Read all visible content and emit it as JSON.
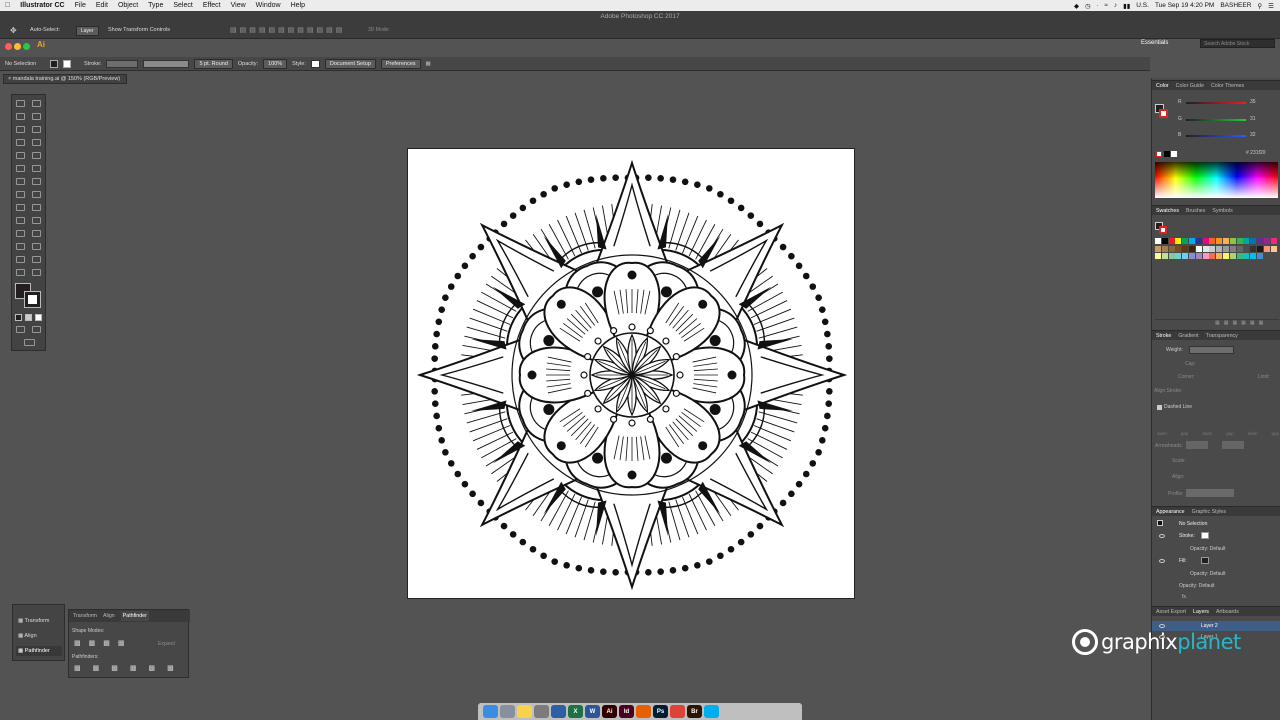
{
  "menubar": {
    "apple": "",
    "app_name": "Illustrator CC",
    "items": [
      "File",
      "Edit",
      "Object",
      "Type",
      "Select",
      "Effect",
      "View",
      "Window",
      "Help"
    ],
    "right": {
      "locale": "U.S.",
      "clock": "Tue Sep 19  4:20 PM",
      "user": "BASHEER"
    }
  },
  "window_title": "Adobe Photoshop CC 2017",
  "options": {
    "auto_select": "Auto-Select:",
    "auto_select_value": "Layer",
    "show_transform": "Show Transform Controls",
    "mode3d": "3D Mode:",
    "workspace": "Essentials",
    "search_placeholder": "Search Adobe Stock"
  },
  "control": {
    "selection": "No Selection",
    "stroke_label": "Stroke:",
    "brush": "5 pt. Round",
    "opacity_label": "Opacity:",
    "opacity_value": "100%",
    "style_label": "Style:",
    "document_setup": "Document Setup",
    "preferences": "Preferences"
  },
  "document_tab": "mandala training.ai @ 150% (RGB/Preview)",
  "color_panel": {
    "tabs": [
      "Color",
      "Color Guide",
      "Color Themes"
    ],
    "r_label": "R",
    "r_value": "35",
    "g_label": "G",
    "g_value": "31",
    "b_label": "B",
    "b_value": "32",
    "hex_value": "231f20"
  },
  "swatches_panel": {
    "tabs": [
      "Swatches",
      "Brushes",
      "Symbols"
    ],
    "colors": [
      "#ffffff",
      "#000000",
      "#ed1c24",
      "#fff200",
      "#00a651",
      "#00aeef",
      "#2e3192",
      "#ec008c",
      "#f26522",
      "#f7941d",
      "#fbaf5d",
      "#8dc63f",
      "#39b54a",
      "#00a99d",
      "#0072bc",
      "#662d91",
      "#92278f",
      "#ee2a7b",
      "#c69c6d",
      "#a67c52",
      "#8c6239",
      "#754c24",
      "#603913",
      "#3c2415",
      "#ffffff",
      "#e6e6e6",
      "#cccccc",
      "#b3b3b3",
      "#999999",
      "#808080",
      "#666666",
      "#4d4d4d",
      "#333333",
      "#1a1a1a",
      "#f7977a",
      "#fdc68a",
      "#fff79a",
      "#c4df9b",
      "#82ca9c",
      "#7accc8",
      "#6dcff6",
      "#8393ca",
      "#a187be",
      "#f49ac2",
      "#f26c4f",
      "#fbaf5d",
      "#fff467",
      "#acd373",
      "#3cb878",
      "#1cbbb4",
      "#00bff3",
      "#448ccb"
    ]
  },
  "stroke_panel": {
    "tabs": [
      "Stroke",
      "Gradient",
      "Transparency"
    ],
    "weight_label": "Weight:",
    "cap_label": "Cap:",
    "corner_label": "Corner:",
    "limit_label": "Limit:",
    "align_label": "Align Stroke:",
    "dashed_label": "Dashed Line",
    "dash_labels": [
      "dash",
      "gap",
      "dash",
      "gap",
      "dash",
      "gap"
    ],
    "arrowheads_label": "Arrowheads:",
    "scale_label": "Scale:",
    "align2_label": "Align:",
    "profile_label": "Profile:"
  },
  "appearance_panel": {
    "tabs": [
      "Appearance",
      "Graphic Styles"
    ],
    "selection": "No Selection",
    "stroke_label": "Stroke:",
    "stroke_opacity": "Opacity: Default",
    "fill_label": "Fill:",
    "fill_opacity": "Opacity: Default",
    "opacity": "Opacity: Default",
    "fx": "fx."
  },
  "layers_panel": {
    "tabs": [
      "Asset Export",
      "Layers",
      "Artboards"
    ],
    "layers": [
      "Layer 2",
      "Layer 1"
    ]
  },
  "transform_stack": [
    "Transform",
    "Align",
    "Pathfinder"
  ],
  "pathfinder_panel": {
    "tabs": [
      "Transform",
      "Align",
      "Pathfinder"
    ],
    "shape_modes": "Shape Modes:",
    "expand": "Expand",
    "pathfinders": "Pathfinders:"
  },
  "dock": {
    "apps": [
      {
        "name": "Finder",
        "color": "#3b8de0",
        "label": ""
      },
      {
        "name": "Launchpad",
        "color": "#8a8fa0",
        "label": ""
      },
      {
        "name": "Notes",
        "color": "#f5d34b",
        "label": ""
      },
      {
        "name": "System Preferences",
        "color": "#7b7b7b",
        "label": ""
      },
      {
        "name": "Box",
        "color": "#2e5fa3",
        "label": ""
      },
      {
        "name": "Excel",
        "color": "#1e7145",
        "label": "X"
      },
      {
        "name": "Word",
        "color": "#2b579a",
        "label": "W"
      },
      {
        "name": "Illustrator",
        "color": "#300000",
        "label": "Ai"
      },
      {
        "name": "InDesign",
        "color": "#49021f",
        "label": "Id"
      },
      {
        "name": "Firefox",
        "color": "#e66000",
        "label": ""
      },
      {
        "name": "Photoshop",
        "color": "#001d34",
        "label": "Ps"
      },
      {
        "name": "Chrome",
        "color": "#db4437",
        "label": ""
      },
      {
        "name": "Bridge",
        "color": "#2b1500",
        "label": "Br"
      },
      {
        "name": "Skype",
        "color": "#00aff0",
        "label": ""
      },
      {
        "name": "Trash",
        "color": "#bfbfbf",
        "label": ""
      }
    ]
  },
  "watermark": {
    "part1": "graphix",
    "part2": "planet"
  }
}
